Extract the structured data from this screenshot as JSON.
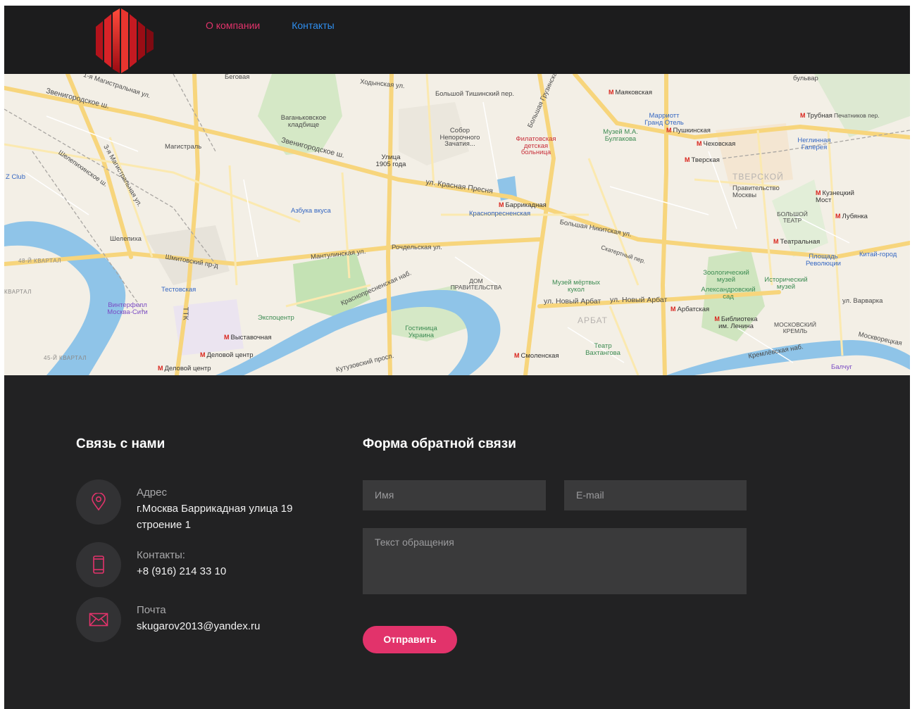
{
  "nav": {
    "items": [
      "О компании",
      "Контакты"
    ]
  },
  "map": {
    "labels": {
      "begovaya": "Беговая",
      "magistr1": "1-я Магистральная ул.",
      "zvenigorod1": "Звенигородское ш.",
      "khodynskaya": "Ходынская ул.",
      "b_tishinsky": "Большой Тишинский пер.",
      "b_gruzinskaya": "Большая Грузинская",
      "vagankovo": "Ваганьковское кладбище",
      "sobor": "Собор Непорочного Зачатия...",
      "magistral": "Магистраль",
      "zvenigorod2": "Звенигородское ш.",
      "ul1905": "Улица 1905 года",
      "filatov": "Филатовская детская больница",
      "mayakovskaya": "Маяковская",
      "marriott": "Марриотт Гранд Отель",
      "bulgakov": "Музей М.А. Булгакова",
      "pushkinskaya": "Пушкинская",
      "chekhovskaya": "Чеховская",
      "tverskaya": "Тверская",
      "trubnaya": "Трубная",
      "neglinnaya": "Неглинная Галерея",
      "pechatnikov": "Печатников пер.",
      "bulvar": "бульвар",
      "zclub": "Z Club",
      "shelepikha_sh": "Шелепихинское ш.",
      "magistr3": "3-я Магистральная ул.",
      "krasnaya_presnya": "ул. Красная Пресня",
      "barrikadnaya": "Баррикадная",
      "krasnopresnenskaya": "Краснопресненская",
      "azbuka": "Азбука вкуса",
      "tverskoy": "ТВЕРСКОЙ",
      "pravitelstvo": "Правительство Москвы",
      "bolshoi": "БОЛЬШОЙ ТЕАТР",
      "kuznetsky": "Кузнецкий Мост",
      "lubyanka": "Лубянка",
      "shelepikha": "Шелепиха",
      "shmitovsky": "Шмитовский пр-д",
      "mantulinskaya": "Мантулинская ул.",
      "rochdelskaya": "Рочдельская ул.",
      "b_nikitskaya": "Большая Никитская ул.",
      "skaterny": "Скатертный пер.",
      "teatralnaya": "Театральная",
      "ploshchad_rev": "Площадь Революции",
      "kitay_gorod": "Китай-город",
      "kvartal48": "48-Й КВАРТАЛ",
      "testovskaya": "Тестовская",
      "dom_prav": "ДОМ ПРАВИТЕЛЬСТВА",
      "kuklov": "Музей мёртвых кукол",
      "zoo_museum": "Зоологический музей",
      "alex_sad": "Александровский сад",
      "ist_museum": "Исторический музей",
      "kvartal": "КВАРТАЛ",
      "vintefell": "Винтерфелл Москва-Сити",
      "expocentr": "Экспоцентр",
      "n_arbat1": "ул. Новый Арбат",
      "n_arbat2": "ул. Новый Арбат",
      "arbatskaya": "Арбатская",
      "varvarka": "ул. Варварка",
      "gostinitsa": "Гостиница Украина",
      "arbat": "АРБАТ",
      "biblioteka": "Библиотека им. Ленина",
      "kreml": "МОСКОВСКИЙ КРЕМЛЬ",
      "vystavochnaya": "Выставочная",
      "delovoy": "Деловой центр",
      "teatr_vakht": "Театр Вахтангова",
      "smolenskaya": "Смоленская",
      "kremlevskaya": "Кремлёвская наб.",
      "moskvoretskaya": "Москворецкая",
      "kvartal45": "45-Й КВАРТАЛ",
      "kutuzovsky": "Кутузовский просп.",
      "balchug": "Балчуг",
      "delovoy2": "Деловой центр",
      "ttk": "ТТК",
      "krasnopresn_nab": "Краснопресненская наб."
    }
  },
  "contacts": {
    "title": "Связь с нами",
    "address_title": "Адрес",
    "address_line1": "г.Москва Баррикадная улица 19",
    "address_line2": "строение 1",
    "phone_title": "Контакты:",
    "phone": "+8 (916) 214 33 10",
    "mail_title": "Почта",
    "mail": "skugarov2013@yandex.ru"
  },
  "form": {
    "title": "Форма обратной связи",
    "name_placeholder": "Имя",
    "email_placeholder": "E-mail",
    "message_placeholder": "Текст обращения",
    "submit_label": "Отправить"
  },
  "colors": {
    "accent": "#e2336b",
    "link_blue": "#2f8ff0",
    "background": "#222223"
  },
  "icons": {
    "address": "map-pin-icon",
    "phone": "mobile-phone-icon",
    "mail": "envelope-icon"
  }
}
